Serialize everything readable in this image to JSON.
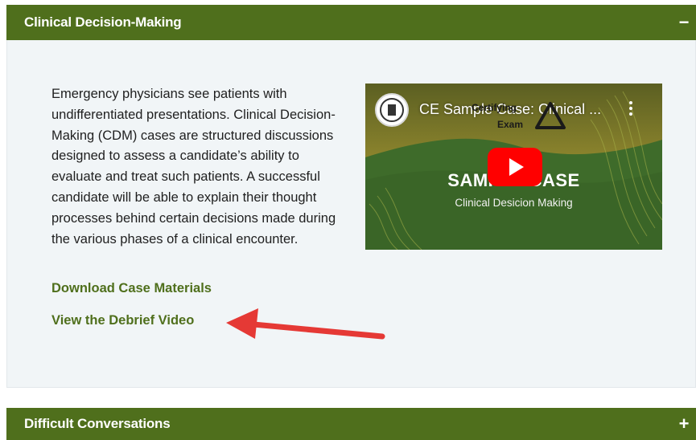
{
  "accordion": [
    {
      "title": "Clinical Decision-Making",
      "toggle": "−",
      "expanded": true,
      "description": "Emergency physicians see patients with undifferentiated presentations. Clinical Decision-Making (CDM) cases are structured discussions designed to assess a candidate’s ability to evaluate and treat such patients. A successful candidate will be able to explain their thought processes behind certain decisions made during the various phases of a clinical encounter.",
      "links": {
        "download": "Download Case Materials",
        "debrief": "View the Debrief Video"
      },
      "video": {
        "title": "CE Sample Case: Clinical ...",
        "badge_line1": "Certifying",
        "badge_line2": "Exam",
        "big_text": "SAMPLE CASE",
        "sub_text": "Clinical Desicion Making",
        "channel_icon": "seal-icon",
        "play_icon": "play-icon",
        "menu_icon": "kebab-menu-icon"
      }
    },
    {
      "title": "Difficult Conversations",
      "toggle": "+",
      "expanded": false
    }
  ],
  "colors": {
    "header_green": "#4f6f1c",
    "panel_bg": "#f1f5f7",
    "link_green": "#4f6f1c",
    "annotation_arrow": "#e53935",
    "play_red": "#ff0000"
  }
}
